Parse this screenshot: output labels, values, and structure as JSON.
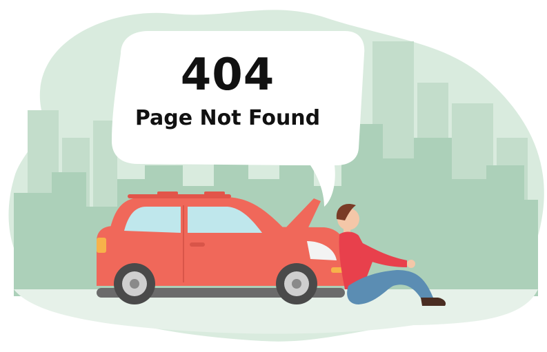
{
  "error": {
    "code": "404",
    "message": "Page Not Found"
  },
  "colors": {
    "blob": "#d9ebde",
    "skyline_far": "#b9d8c3",
    "skyline_near": "#a8ccb5",
    "car_body": "#f0685a",
    "car_window": "#bfe7ec",
    "person_shirt": "#e8404c",
    "person_pants": "#5b8db3"
  },
  "icons": [
    "speech-bubble",
    "broken-down-car",
    "sitting-person"
  ]
}
